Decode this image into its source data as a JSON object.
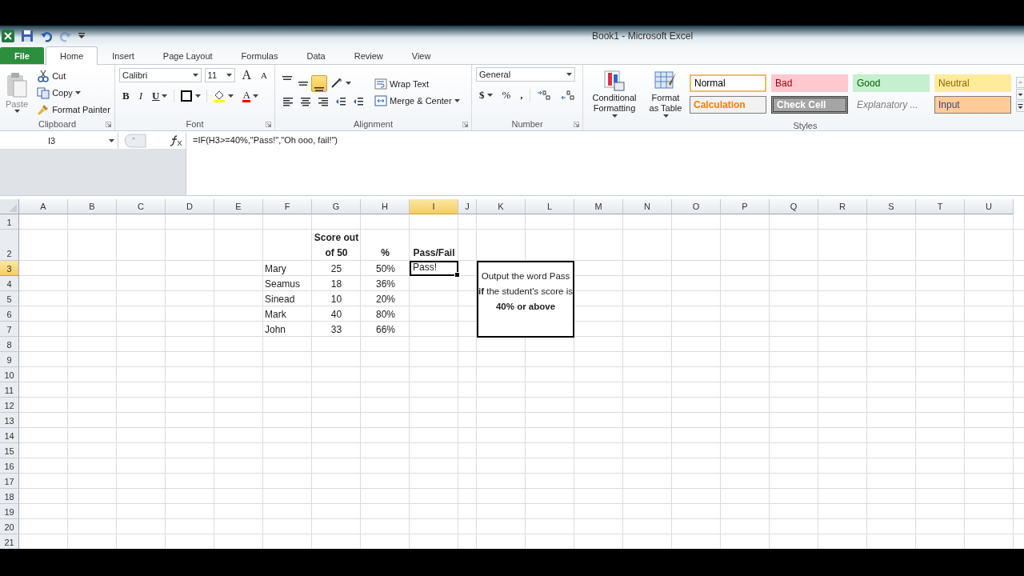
{
  "quick_access": [
    {
      "kind": "save",
      "disabled": false
    },
    {
      "kind": "undo",
      "disabled": false
    },
    {
      "kind": "redo",
      "disabled": true
    }
  ],
  "window": {
    "title": "Book1  -  Microsoft Excel"
  },
  "tabs": [
    {
      "label": "File",
      "kind": "file",
      "selected": false
    },
    {
      "label": "Home",
      "kind": "tab",
      "selected": true
    },
    {
      "label": "Insert",
      "kind": "tab",
      "selected": false
    },
    {
      "label": "Page Layout",
      "kind": "tab",
      "selected": false
    },
    {
      "label": "Formulas",
      "kind": "tab",
      "selected": false
    },
    {
      "label": "Data",
      "kind": "tab",
      "selected": false
    },
    {
      "label": "Review",
      "kind": "tab",
      "selected": false
    },
    {
      "label": "View",
      "kind": "tab",
      "selected": false
    }
  ],
  "clipboard": {
    "label": "Clipboard",
    "paste": "Paste",
    "cut": "Cut",
    "copy": "Copy",
    "format_painter": "Format Painter"
  },
  "font": {
    "label": "Font",
    "name": "Calibri",
    "size": "11",
    "grow": "A",
    "shrink": "A",
    "bold": "B",
    "italic": "I",
    "underline": "U",
    "font_color": "A"
  },
  "alignment": {
    "label": "Alignment",
    "vertical": [
      {
        "selected": false
      },
      {
        "selected": false
      },
      {
        "selected": true
      }
    ],
    "wrap_text": "Wrap Text",
    "merge": "Merge & Center"
  },
  "number": {
    "label": "Number",
    "format": "General",
    "currency": "$",
    "percent": "%",
    "comma": ","
  },
  "styles": {
    "label": "Styles",
    "conditional": "Conditional Formatting",
    "format_table": "Format as Table",
    "gallery": [
      {
        "label": "Normal",
        "kind": "normal",
        "selected": true
      },
      {
        "label": "Bad",
        "kind": "bad",
        "selected": false
      },
      {
        "label": "Good",
        "kind": "good",
        "selected": false
      },
      {
        "label": "Neutral",
        "kind": "neutral",
        "selected": false
      },
      {
        "label": "Calculation",
        "kind": "calculation",
        "selected": false
      },
      {
        "label": "Check Cell",
        "kind": "check",
        "selected": false
      },
      {
        "label": "Explanatory ...",
        "kind": "explanatory",
        "selected": false
      },
      {
        "label": "Input",
        "kind": "input",
        "selected": false
      }
    ]
  },
  "formula_bar": {
    "name_box": "I3",
    "formula": "=IF(H3>=40%,\"Pass!\",\"Oh ooo, fail!\")"
  },
  "sheet": {
    "columns": [
      {
        "label": "A",
        "selected": false
      },
      {
        "label": "B",
        "selected": false
      },
      {
        "label": "C",
        "selected": false
      },
      {
        "label": "D",
        "selected": false
      },
      {
        "label": "E",
        "selected": false
      },
      {
        "label": "F",
        "selected": false
      },
      {
        "label": "G",
        "selected": false
      },
      {
        "label": "H",
        "selected": false
      },
      {
        "label": "I",
        "selected": true
      },
      {
        "label": "J",
        "selected": false
      },
      {
        "label": "K",
        "selected": false
      },
      {
        "label": "L",
        "selected": false
      },
      {
        "label": "M",
        "selected": false
      },
      {
        "label": "N",
        "selected": false
      },
      {
        "label": "O",
        "selected": false
      },
      {
        "label": "P",
        "selected": false
      },
      {
        "label": "Q",
        "selected": false
      },
      {
        "label": "R",
        "selected": false
      },
      {
        "label": "S",
        "selected": false
      },
      {
        "label": "T",
        "selected": false
      },
      {
        "label": "U",
        "selected": false
      }
    ],
    "rows": [
      {
        "label": "1",
        "selected": false
      },
      {
        "label": "2",
        "selected": false,
        "tall": true,
        "cells": [
          null,
          null,
          null,
          null,
          null,
          null,
          {
            "text": "Score out of 50",
            "kind": "header",
            "selected": false
          },
          {
            "text": "%",
            "kind": "header",
            "selected": false
          },
          {
            "text": "Pass/Fail",
            "kind": "header",
            "selected": false
          }
        ]
      },
      {
        "label": "3",
        "selected": true,
        "cells": [
          null,
          null,
          null,
          null,
          null,
          {
            "text": "Mary",
            "kind": "label",
            "selected": false
          },
          {
            "text": "25",
            "kind": "number",
            "selected": false
          },
          {
            "text": "50%",
            "kind": "percent",
            "selected": false
          },
          {
            "text": "Pass!",
            "kind": "label",
            "selected": true
          }
        ]
      },
      {
        "label": "4",
        "selected": false,
        "cells": [
          null,
          null,
          null,
          null,
          null,
          {
            "text": "Seamus",
            "kind": "label",
            "selected": false
          },
          {
            "text": "18",
            "kind": "number",
            "selected": false
          },
          {
            "text": "36%",
            "kind": "percent",
            "selected": false
          }
        ]
      },
      {
        "label": "5",
        "selected": false,
        "cells": [
          null,
          null,
          null,
          null,
          null,
          {
            "text": "Sinead",
            "kind": "label",
            "selected": false
          },
          {
            "text": "10",
            "kind": "number",
            "selected": false
          },
          {
            "text": "20%",
            "kind": "percent",
            "selected": false
          }
        ]
      },
      {
        "label": "6",
        "selected": false,
        "cells": [
          null,
          null,
          null,
          null,
          null,
          {
            "text": "Mark",
            "kind": "label",
            "selected": false
          },
          {
            "text": "40",
            "kind": "number",
            "selected": false
          },
          {
            "text": "80%",
            "kind": "percent",
            "selected": false
          }
        ]
      },
      {
        "label": "7",
        "selected": false,
        "cells": [
          null,
          null,
          null,
          null,
          null,
          {
            "text": "John",
            "kind": "label",
            "selected": false
          },
          {
            "text": "33",
            "kind": "number",
            "selected": false
          },
          {
            "text": "66%",
            "kind": "percent",
            "selected": false
          }
        ]
      },
      {
        "label": "8",
        "selected": false
      },
      {
        "label": "9",
        "selected": false
      },
      {
        "label": "10",
        "selected": false
      },
      {
        "label": "11",
        "selected": false
      },
      {
        "label": "12",
        "selected": false
      },
      {
        "label": "13",
        "selected": false
      },
      {
        "label": "14",
        "selected": false
      },
      {
        "label": "15",
        "selected": false
      },
      {
        "label": "16",
        "selected": false
      },
      {
        "label": "17",
        "selected": false
      },
      {
        "label": "18",
        "selected": false
      },
      {
        "label": "19",
        "selected": false
      },
      {
        "label": "20",
        "selected": false
      },
      {
        "label": "21",
        "selected": false
      }
    ],
    "text_box": {
      "text": "Output the word Pass **if** the student's score is  **40% or above**"
    }
  }
}
